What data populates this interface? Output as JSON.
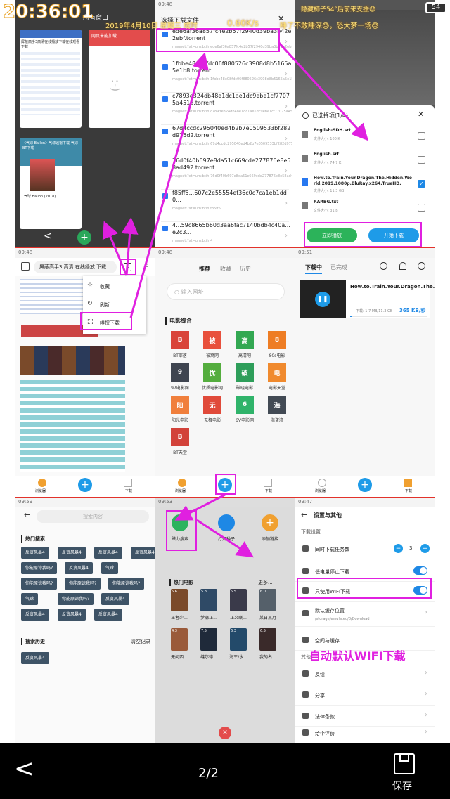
{
  "overlay": {
    "time": "20:36:01",
    "date_line": "2019年4月10日 星期三 成时",
    "speed": "0.60K/s",
    "sleep_note": "睡了不敢睡深😓，恐大梦一场😓",
    "battery_note": "隐藏柿子54°后前来支援😓",
    "battery_level": "54"
  },
  "p1": {
    "title": "所有窗口",
    "card1_title": "屏蔽高手3高清在线播放下载在线观看下载",
    "card2_title": "网页未能加载",
    "sad_face": ":-)",
    "card3_title": "《气球 Ballon》气球迅雷下载-气球BT下载",
    "card3_caption": "气球 Ballon (2018)",
    "back": "<",
    "add": "+"
  },
  "p2": {
    "header": "选择下载文件",
    "close": "✕",
    "torrents": [
      {
        "name": "ede6af36a857fc4e2b57f2940d39ba3b42e2ebf.torrent",
        "magnet": "magnet:?xt=urn:btih:ede6af36a857fc4e2b57f2940d39ba3b42e2ebf"
      },
      {
        "name": "1fbbe48e08fdc06f880526c3908d8b5165a5e1b8.torrent",
        "magnet": "magnet:?xt=urn:btih:1fbbe48e08fdc06f880526c3908d8b5165a5e1b8"
      },
      {
        "name": "c7893e324db48e1dc1ae1dc9ebe1cf77075a451d.torrent",
        "magnet": "magnet:?xt=urn:btih:c7893e324db48e1dc1ae1dc9ebe1cf77075a451d"
      },
      {
        "name": "67d4ccdc295040ed4b2b7e0509533bf282d975d2.torrent",
        "magnet": "magnet:?xt=urn:btih:67d4ccdc295040ed4b2b7e0509533bf282d975d2"
      },
      {
        "name": "76d0f40b697e8da51c669cde277876e8e58ad492.torrent",
        "magnet": "magnet:?xt=urn:btih:76d0f40b697e8da51c669cde277876e8e58ad492"
      },
      {
        "name": "f85ff5...607c2e55554ef36c0c7ca1eb1dd0...",
        "magnet": "magnet:?xt=urn:btih:f85ff5"
      },
      {
        "name": "4...59c8665b60d3aa6fac7140bdb4c40a...e2c3...",
        "magnet": "magnet:?xt=urn:btih:4"
      }
    ]
  },
  "p3": {
    "header": "已选择项(1/4)",
    "close": "✕",
    "files": [
      {
        "name": "English-SDH.srt",
        "size": "文件大小: 100 K",
        "checked": false
      },
      {
        "name": "English.srt",
        "size": "文件大小: 74.7 K",
        "checked": false
      },
      {
        "name": "How.to.Train.Your.Dragon.The.Hidden.World.2019.1080p.BluRay.x264.TrueHD.",
        "size": "文件大小: 11.3 GB",
        "checked": true
      },
      {
        "name": "RARBG.txt",
        "size": "文件大小: 31 B",
        "checked": false
      }
    ],
    "play_btn": "立即播放",
    "download_btn": "开始下载"
  },
  "p4": {
    "time": "09:48",
    "url": "屏蔽高手3 高清 在线播放 下载...",
    "menu": [
      "收藏",
      "刷新",
      "嗅探下载"
    ],
    "nav_left": "浏览器",
    "nav_right": "下载"
  },
  "p5": {
    "time": "09:48",
    "tabs": [
      "推荐",
      "收藏",
      "历史"
    ],
    "url_placeholder": "输入网址",
    "section": "电影综合",
    "sites": [
      {
        "glyph": "B",
        "label": "BT部落",
        "color": "#d9443a"
      },
      {
        "glyph": "被",
        "label": "被窝网",
        "color": "#e8503c"
      },
      {
        "glyph": "高",
        "label": "高清吧",
        "color": "#33a852"
      },
      {
        "glyph": "8",
        "label": "80s电影",
        "color": "#ee7d24"
      },
      {
        "glyph": "9",
        "label": "97电影网",
        "color": "#3f4550"
      },
      {
        "glyph": "优",
        "label": "优质电影网",
        "color": "#54ad3e"
      },
      {
        "glyph": "破",
        "label": "破晓电影",
        "color": "#2e9e5a"
      },
      {
        "glyph": "电",
        "label": "电影天堂",
        "color": "#f08a2e"
      },
      {
        "glyph": "阳",
        "label": "阳光电影",
        "color": "#f07f3c"
      },
      {
        "glyph": "无",
        "label": "无极电影",
        "color": "#e04a3a"
      },
      {
        "glyph": "6",
        "label": "6V电影网",
        "color": "#2fb36a"
      },
      {
        "glyph": "海",
        "label": "海盗湾",
        "color": "#424a54"
      },
      {
        "glyph": "B",
        "label": "BT天堂",
        "color": "#d2423a"
      }
    ],
    "nav_left": "浏览器",
    "nav_right": "下载"
  },
  "p6": {
    "time": "09:51",
    "tabs": [
      "下载中",
      "已完成"
    ],
    "task_name": "How.to.Train.Your.Dragon.The.Hidden.World.",
    "task_size": "下载: 1.7 MB/11.3 GB",
    "task_speed": "365 KB/秒",
    "progress": 0.02,
    "nav_left": "浏览器",
    "nav_right": "下载"
  },
  "p7": {
    "time": "09:59",
    "search_placeholder": "搜索内容",
    "hot_title": "热门搜索",
    "chips": [
      "反贪风暴4",
      "反贪风暴4",
      "反贪风暴4",
      "反贪风暴4",
      "你能原谅我吗?",
      "反贪风暴4",
      "气球",
      "你能原谅我吗?",
      "你能原谅我吗?",
      "你能原谅我吗?",
      "气球",
      "你能原谅我吗?",
      "反贪风暴4",
      "反贪风暴4",
      "反贪风暴4",
      "反贪风暴4"
    ],
    "history_title": "搜索历史",
    "clear": "清空记录",
    "history": [
      "反贪风暴4"
    ]
  },
  "p8": {
    "time": "09:53",
    "actions": [
      "磁力搜索",
      "打开种子",
      "添加链接"
    ],
    "hot_title": "热门电影",
    "more": "更多...",
    "posters": [
      {
        "score": "5.6",
        "title": "王者少...",
        "color": "#7a4a2a"
      },
      {
        "score": "5.8",
        "title": "梦寐正...",
        "color": "#2f4a66"
      },
      {
        "score": "5.5",
        "title": "正义联...",
        "color": "#3a3a4a"
      },
      {
        "score": "6.0",
        "title": "某日某月",
        "color": "#55606a"
      },
      {
        "score": "4.3",
        "title": "无问西...",
        "color": "#9a5a3a"
      },
      {
        "score": "7.5",
        "title": "缝尔德...",
        "color": "#1f2a3a"
      },
      {
        "score": "6.3",
        "title": "海王/水...",
        "color": "#234a6a"
      },
      {
        "score": "6.5",
        "title": "我的名...",
        "color": "#3a2a2a"
      }
    ],
    "close": "✕"
  },
  "p9": {
    "time": "09:47",
    "title": "设置与其他",
    "section": "下载设置",
    "concurrent_label": "同时下载任务数",
    "concurrent_value": "3",
    "minus": "−",
    "plus": "+",
    "low_battery": "低电量停止下载",
    "wifi_only": "只使用WIFI下载",
    "path_label": "默认缓存位置",
    "path_value": "/storage/emulated/0/Download",
    "space": "空间与缓存",
    "other": "其他",
    "feedback": "反馈",
    "share": "分享",
    "legal": "法律条款",
    "rate": "给个评价",
    "annotation": "自动默认WIFI下载"
  },
  "bottom": {
    "back": "<",
    "page": "2/2",
    "save": "保存"
  }
}
